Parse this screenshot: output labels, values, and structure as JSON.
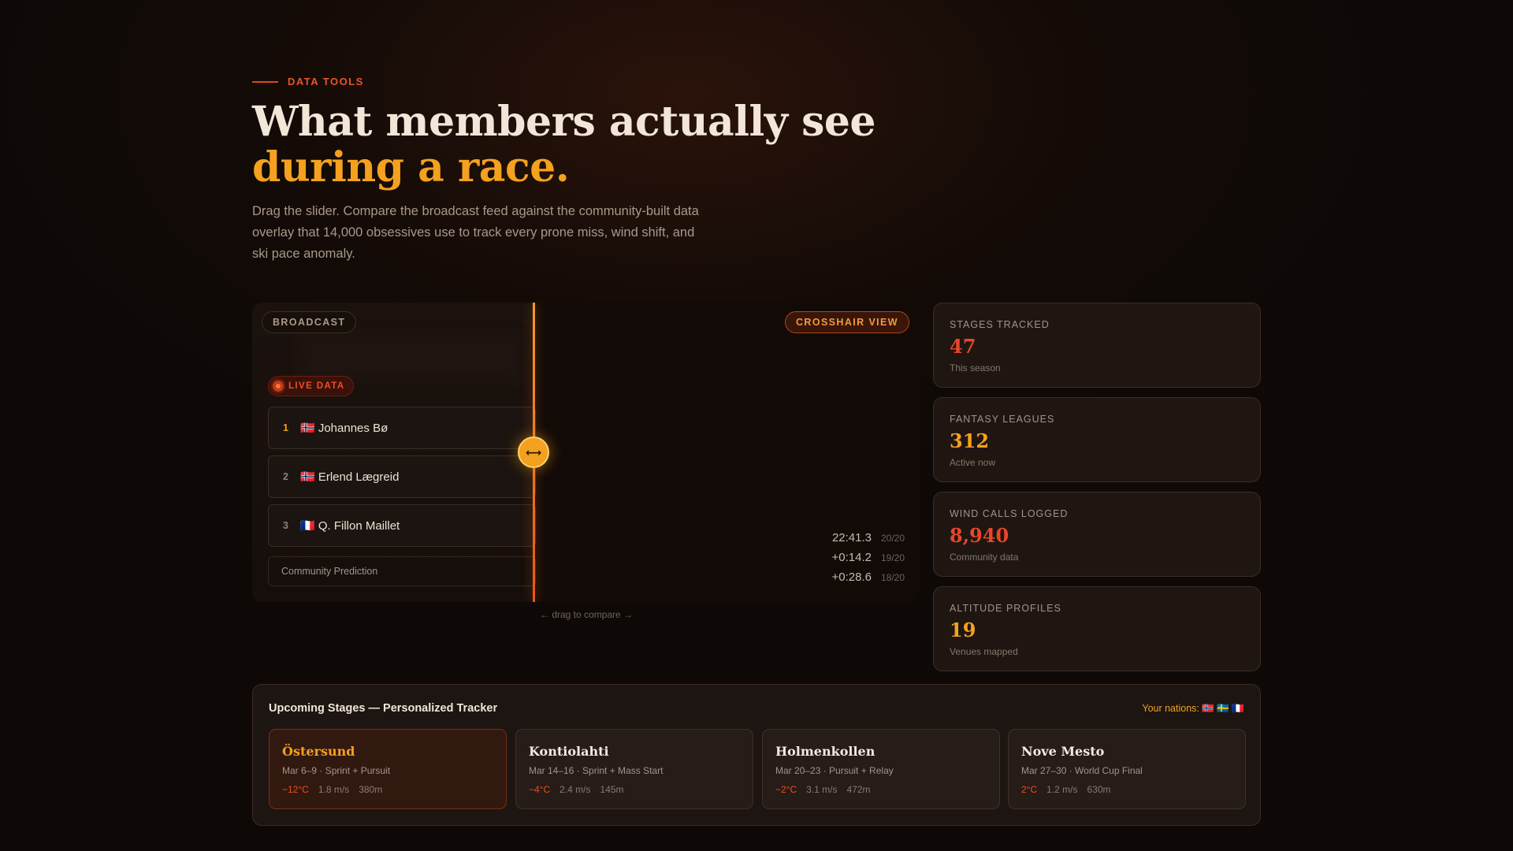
{
  "eyebrow": "DATA TOOLS",
  "headline": {
    "line1": "What members actually see",
    "line2": "during a race."
  },
  "lede": "Drag the slider. Compare the broadcast feed against the community-built data overlay that 14,000 obsessives use to track every prone miss, wind shift, and ski pace anomaly.",
  "compare": {
    "broadcast_label": "BROADCAST",
    "crosshair_label": "CROSSHAIR VIEW",
    "live_label": "LIVE DATA",
    "rankings": [
      {
        "rank": "1",
        "name": "🇳🇴 Johannes Bø"
      },
      {
        "rank": "2",
        "name": "🇳🇴 Erlend Lægreid"
      },
      {
        "rank": "3",
        "name": "🇫🇷 Q. Fillon Maillet"
      }
    ],
    "prediction_label": "Community Prediction",
    "times": [
      {
        "time": "22:41.3",
        "shots": "20/20"
      },
      {
        "time": "+0:14.2",
        "shots": "19/20"
      },
      {
        "time": "+0:28.6",
        "shots": "18/20"
      }
    ],
    "handle_icon": "⟷",
    "drag_hint": "← drag to compare →"
  },
  "stats": [
    {
      "label": "STAGES TRACKED",
      "value": "47",
      "sub": "This season",
      "color": "#e8462a"
    },
    {
      "label": "FANTASY LEAGUES",
      "value": "312",
      "sub": "Active now",
      "color": "#f3a11f"
    },
    {
      "label": "WIND CALLS LOGGED",
      "value": "8,940",
      "sub": "Community data",
      "color": "#e8462a"
    },
    {
      "label": "ALTITUDE PROFILES",
      "value": "19",
      "sub": "Venues mapped",
      "color": "#f3a11f"
    }
  ],
  "upcoming": {
    "title": "Upcoming Stages — Personalized Tracker",
    "nations": "Your nations: 🇳🇴 🇸🇪 🇫🇷",
    "stages": [
      {
        "name": "Östersund",
        "date": "Mar 6–9 · Sprint + Pursuit",
        "temp": "−12°C",
        "wind": "1.8 m/s",
        "alt": "380m"
      },
      {
        "name": "Kontiolahti",
        "date": "Mar 14–16 · Sprint + Mass Start",
        "temp": "−4°C",
        "wind": "2.4 m/s",
        "alt": "145m"
      },
      {
        "name": "Holmenkollen",
        "date": "Mar 20–23 · Pursuit + Relay",
        "temp": "−2°C",
        "wind": "3.1 m/s",
        "alt": "472m"
      },
      {
        "name": "Nove Mesto",
        "date": "Mar 27–30 · World Cup Final",
        "temp": "2°C",
        "wind": "1.2 m/s",
        "alt": "630m"
      }
    ]
  }
}
